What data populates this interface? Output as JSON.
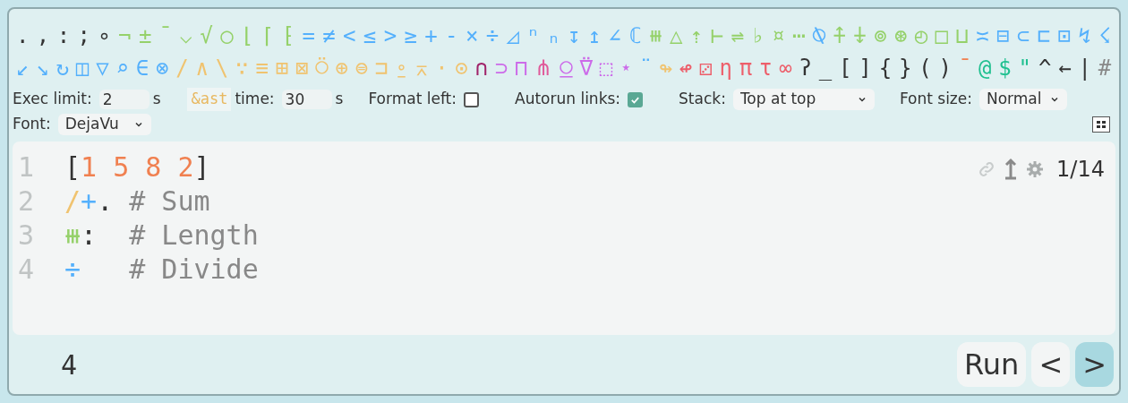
{
  "glyph_rows": [
    [
      {
        "text": ".",
        "color": "#333333"
      },
      {
        "text": ",",
        "color": "#333333"
      },
      {
        "text": ":",
        "color": "#333333"
      },
      {
        "text": ";",
        "color": "#333333"
      },
      {
        "text": "∘",
        "color": "#333333"
      },
      {
        "text": "¬",
        "color": "#95d16a"
      },
      {
        "text": "±",
        "color": "#95d16a"
      },
      {
        "text": "¯",
        "color": "#95d16a"
      },
      {
        "text": "⌵",
        "color": "#95d16a"
      },
      {
        "text": "√",
        "color": "#95d16a"
      },
      {
        "text": "○",
        "color": "#95d16a"
      },
      {
        "text": "⌊",
        "color": "#95d16a"
      },
      {
        "text": "⌈",
        "color": "#95d16a"
      },
      {
        "text": "⁅",
        "color": "#95d16a"
      },
      {
        "text": "=",
        "color": "#54b0fc"
      },
      {
        "text": "≠",
        "color": "#54b0fc"
      },
      {
        "text": "<",
        "color": "#54b0fc"
      },
      {
        "text": "≤",
        "color": "#54b0fc"
      },
      {
        "text": ">",
        "color": "#54b0fc"
      },
      {
        "text": "≥",
        "color": "#54b0fc"
      },
      {
        "text": "+",
        "color": "#54b0fc"
      },
      {
        "text": "-",
        "color": "#54b0fc"
      },
      {
        "text": "×",
        "color": "#54b0fc"
      },
      {
        "text": "÷",
        "color": "#54b0fc"
      },
      {
        "text": "◿",
        "color": "#54b0fc"
      },
      {
        "text": "ⁿ",
        "color": "#54b0fc"
      },
      {
        "text": "ₙ",
        "color": "#54b0fc"
      },
      {
        "text": "↧",
        "color": "#54b0fc"
      },
      {
        "text": "↥",
        "color": "#54b0fc"
      },
      {
        "text": "∠",
        "color": "#54b0fc"
      },
      {
        "text": "ℂ",
        "color": "#54b0fc"
      },
      {
        "text": "⧻",
        "color": "#95d16a"
      },
      {
        "text": "△",
        "color": "#95d16a"
      },
      {
        "text": "⇡",
        "color": "#95d16a"
      },
      {
        "text": "⊢",
        "color": "#95d16a"
      },
      {
        "text": "⇌",
        "color": "#95d16a"
      },
      {
        "text": "♭",
        "color": "#95d16a"
      },
      {
        "text": "¤",
        "color": "#95d16a"
      },
      {
        "text": "⋯",
        "color": "#95d16a"
      },
      {
        "text": "⍉",
        "color": "#54b0fc"
      },
      {
        "text": "⍏",
        "color": "#95d16a"
      },
      {
        "text": "⍖",
        "color": "#95d16a"
      },
      {
        "text": "⊚",
        "color": "#95d16a"
      },
      {
        "text": "⊛",
        "color": "#95d16a"
      },
      {
        "text": "◴",
        "color": "#95d16a"
      },
      {
        "text": "□",
        "color": "#95d16a"
      },
      {
        "text": "⊔",
        "color": "#95d16a"
      },
      {
        "text": "≍",
        "color": "#54b0fc"
      },
      {
        "text": "⊟",
        "color": "#54b0fc"
      },
      {
        "text": "⊂",
        "color": "#54b0fc"
      },
      {
        "text": "⊏",
        "color": "#54b0fc"
      },
      {
        "text": "⊡",
        "color": "#54b0fc"
      },
      {
        "text": "↯",
        "color": "#54b0fc"
      },
      {
        "text": "☇",
        "color": "#54b0fc"
      }
    ],
    [
      {
        "text": "↙",
        "color": "#54b0fc"
      },
      {
        "text": "↘",
        "color": "#54b0fc"
      },
      {
        "text": "↻",
        "color": "#54b0fc"
      },
      {
        "text": "◫",
        "color": "#54b0fc"
      },
      {
        "text": "▽",
        "color": "#54b0fc"
      },
      {
        "text": "⌕",
        "color": "#54b0fc"
      },
      {
        "text": "∈",
        "color": "#54b0fc"
      },
      {
        "text": "⊗",
        "color": "#54b0fc"
      },
      {
        "text": "/",
        "color": "#f0c36f"
      },
      {
        "text": "∧",
        "color": "#f0c36f"
      },
      {
        "text": "\\",
        "color": "#f0c36f"
      },
      {
        "text": "∵",
        "color": "#f0c36f"
      },
      {
        "text": "≡",
        "color": "#f0c36f"
      },
      {
        "text": "⊞",
        "color": "#f0c36f"
      },
      {
        "text": "⊠",
        "color": "#f0c36f"
      },
      {
        "text": "⍥",
        "color": "#f0c36f"
      },
      {
        "text": "⊕",
        "color": "#f0c36f"
      },
      {
        "text": "⊜",
        "color": "#f0c36f"
      },
      {
        "text": "⊐",
        "color": "#f0c36f"
      },
      {
        "text": "⍛",
        "color": "#f0c36f"
      },
      {
        "text": "⌅",
        "color": "#f0c36f"
      },
      {
        "text": "⋅",
        "color": "#f0c36f"
      },
      {
        "text": "⊙",
        "color": "#f0c36f"
      },
      {
        "text": "∩",
        "color": "#a0236a"
      },
      {
        "text": "⊃",
        "color": "#cc6be9"
      },
      {
        "text": "⊓",
        "color": "#cc6be9"
      },
      {
        "text": "⋔",
        "color": "#e05a9a"
      },
      {
        "text": "⍜",
        "color": "#cc6be9"
      },
      {
        "text": "⍢",
        "color": "#cc6be9"
      },
      {
        "text": "⬚",
        "color": "#cc6be9"
      },
      {
        "text": "⋆",
        "color": "#cc6be9"
      },
      {
        "text": "¨",
        "color": "#54b0fc"
      },
      {
        "text": "↬",
        "color": "#f0c36f"
      },
      {
        "text": "↫",
        "color": "#ed5e6a"
      },
      {
        "text": "⚂",
        "color": "#ed5e6a"
      },
      {
        "text": "η",
        "color": "#ed5e6a"
      },
      {
        "text": "π",
        "color": "#ed5e6a"
      },
      {
        "text": "τ",
        "color": "#ed5e6a"
      },
      {
        "text": "∞",
        "color": "#ed5e6a"
      },
      {
        "text": "ʔ",
        "color": "#333333"
      },
      {
        "text": "_",
        "color": "#333333"
      },
      {
        "text": "[",
        "color": "#333333"
      },
      {
        "text": "]",
        "color": "#333333"
      },
      {
        "text": "{",
        "color": "#333333"
      },
      {
        "text": "}",
        "color": "#333333"
      },
      {
        "text": "(",
        "color": "#333333"
      },
      {
        "text": ")",
        "color": "#333333"
      },
      {
        "text": "¯",
        "color": "#f08050"
      },
      {
        "text": "@",
        "color": "#20c090"
      },
      {
        "text": "$",
        "color": "#20c090"
      },
      {
        "text": "\"",
        "color": "#20c090"
      },
      {
        "text": "^",
        "color": "#333333"
      },
      {
        "text": "←",
        "color": "#333333"
      },
      {
        "text": "|",
        "color": "#333333"
      },
      {
        "text": "#",
        "color": "#888888"
      }
    ]
  ],
  "settings": {
    "exec_limit": {
      "label": "Exec limit:",
      "value": "2",
      "unit": "s"
    },
    "ast_time": {
      "tag": "&ast",
      "label": "time:",
      "value": "30",
      "unit": "s"
    },
    "format_left": {
      "label": "Format left:",
      "checked": false
    },
    "autorun_links": {
      "label": "Autorun links:",
      "checked": true
    },
    "stack": {
      "label": "Stack:",
      "value": "Top at top"
    },
    "font_size": {
      "label": "Font size:",
      "value": "Normal"
    },
    "font": {
      "label": "Font:",
      "value": "DejaVu"
    }
  },
  "editor": {
    "counter": "1/14",
    "lines": [
      {
        "number": "1",
        "tokens": [
          {
            "text": "[",
            "color": "#333333"
          },
          {
            "text": "1 5 8 2",
            "color": "#f08050"
          },
          {
            "text": "]",
            "color": "#333333"
          }
        ]
      },
      {
        "number": "2",
        "tokens": [
          {
            "text": "/",
            "color": "#f0c36f"
          },
          {
            "text": "+",
            "color": "#54b0fc"
          },
          {
            "text": ".",
            "color": "#333333"
          },
          {
            "text": " # Sum",
            "color": "#888888"
          }
        ]
      },
      {
        "number": "3",
        "tokens": [
          {
            "text": "⧻",
            "color": "#95d16a"
          },
          {
            "text": ":",
            "color": "#333333"
          },
          {
            "text": "  # Length",
            "color": "#888888"
          }
        ]
      },
      {
        "number": "4",
        "tokens": [
          {
            "text": "÷",
            "color": "#54b0fc"
          },
          {
            "text": "   # Divide",
            "color": "#888888"
          }
        ]
      }
    ]
  },
  "output": "4",
  "buttons": [
    {
      "label": "Run",
      "selected": false
    },
    {
      "label": "<",
      "selected": false
    },
    {
      "label": ">",
      "selected": true
    }
  ]
}
